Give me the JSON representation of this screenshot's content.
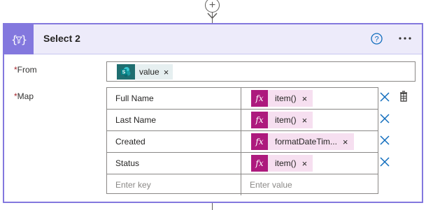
{
  "action": {
    "title": "Select 2",
    "help_tooltip": "?",
    "more_label": "..."
  },
  "from": {
    "label": "From",
    "required_mark": "*",
    "token": {
      "label": "value",
      "remove": "×"
    }
  },
  "map": {
    "label": "Map",
    "required_mark": "*",
    "rows": [
      {
        "key": "Full Name",
        "value": "item()",
        "remove": "×"
      },
      {
        "key": "Last Name",
        "value": "item()",
        "remove": "×"
      },
      {
        "key": "Created",
        "value": "formatDateTim...",
        "remove": "×"
      },
      {
        "key": "Status",
        "value": "item()",
        "remove": "×"
      }
    ],
    "key_placeholder": "Enter key",
    "value_placeholder": "Enter value"
  },
  "colors": {
    "accent": "#8378de",
    "header_bg": "#edebfa",
    "expression": "#ad1a7d",
    "expression_bg": "#f6dff0",
    "sharepoint": "#1f6e70",
    "link_blue": "#0f6cbd"
  },
  "icons": {
    "header": "data-operation-icon",
    "help": "help-circle-icon",
    "more": "more-ellipsis-icon",
    "add": "plus-icon",
    "sharepoint": "sharepoint-icon",
    "expression": "fx-icon",
    "delete": "close-x-icon",
    "clear": "delete-table-icon"
  }
}
